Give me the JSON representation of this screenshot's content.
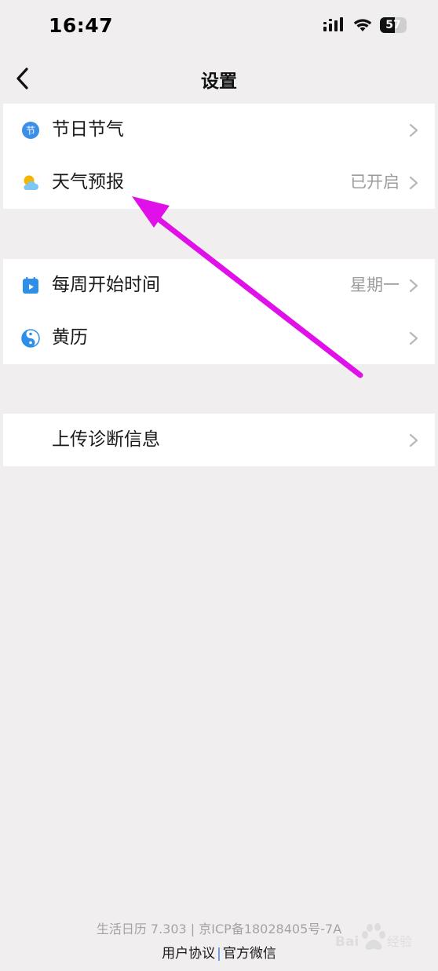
{
  "status_bar": {
    "time": "16:47",
    "battery": "57",
    "battery_level": 0.57
  },
  "nav": {
    "title": "设置",
    "back_icon": "chevron-left-icon"
  },
  "groups": [
    {
      "rows": [
        {
          "label": "节日节气",
          "value": "",
          "icon": "festival-icon",
          "icon_glyph": "节",
          "icon_color": "#3b8fe6"
        },
        {
          "label": "天气预报",
          "value": "已开启",
          "icon": "weather-icon",
          "icon_color": "#f5b400"
        }
      ]
    },
    {
      "rows": [
        {
          "label": "每周开始时间",
          "value": "星期一",
          "icon": "calendar-icon",
          "icon_color": "#2e8fe8"
        },
        {
          "label": "黄历",
          "value": "",
          "icon": "yin-yang-icon",
          "icon_color": "#2e8fe8"
        }
      ]
    },
    {
      "rows": [
        {
          "label": "上传诊断信息",
          "value": "",
          "icon": ""
        }
      ]
    }
  ],
  "footer": {
    "version": "生活日历 7.303 | 京ICP备18028405号-7A",
    "user_agreement": "用户协议",
    "separator": "|",
    "official_wechat": "官方微信"
  },
  "colors": {
    "background": "#f1eef0",
    "card": "#ffffff",
    "accent_blue": "#3f82d8",
    "annotation": "#e010e8"
  }
}
